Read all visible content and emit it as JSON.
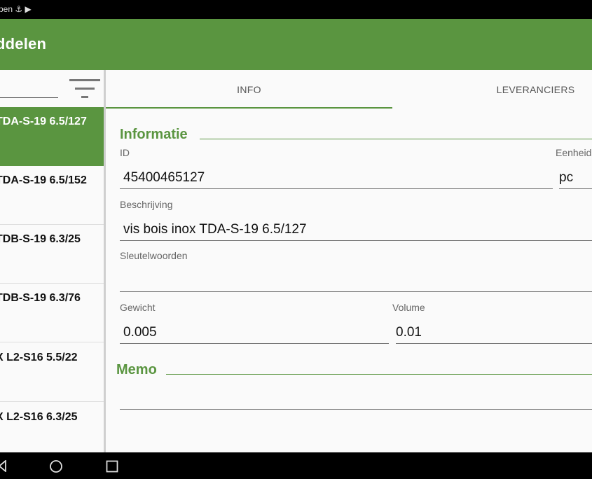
{
  "status": {
    "text": "pen ⚓ ▶"
  },
  "appbar": {
    "title": "ddelen"
  },
  "sidebar": {
    "items": [
      {
        "label": "TDA-S-19 6.5/127"
      },
      {
        "label": "TDA-S-19 6.5/152"
      },
      {
        "label": "TDB-S-19 6.3/25"
      },
      {
        "label": "TDB-S-19 6.3/76"
      },
      {
        "label": "X L2-S16 5.5/22"
      },
      {
        "label": "X L2-S16 6.3/25"
      }
    ]
  },
  "tabs": {
    "info": "INFO",
    "leveranciers": "LEVERANCIERS"
  },
  "informatie": {
    "title": "Informatie",
    "id_label": "ID",
    "id_value": "45400465127",
    "eenheid_label": "Eenheid",
    "eenheid_value": "pc",
    "beschrijving_label": "Beschrijving",
    "beschrijving_value": "vis bois inox TDA-S-19 6.5/127",
    "sleutelwoorden_label": "Sleutelwoorden",
    "sleutelwoorden_value": "",
    "gewicht_label": "Gewicht",
    "gewicht_value": "0.005",
    "volume_label": "Volume",
    "volume_value": "0.01"
  },
  "memo": {
    "title": "Memo",
    "value": ""
  },
  "colors": {
    "accent": "#5a9540"
  }
}
